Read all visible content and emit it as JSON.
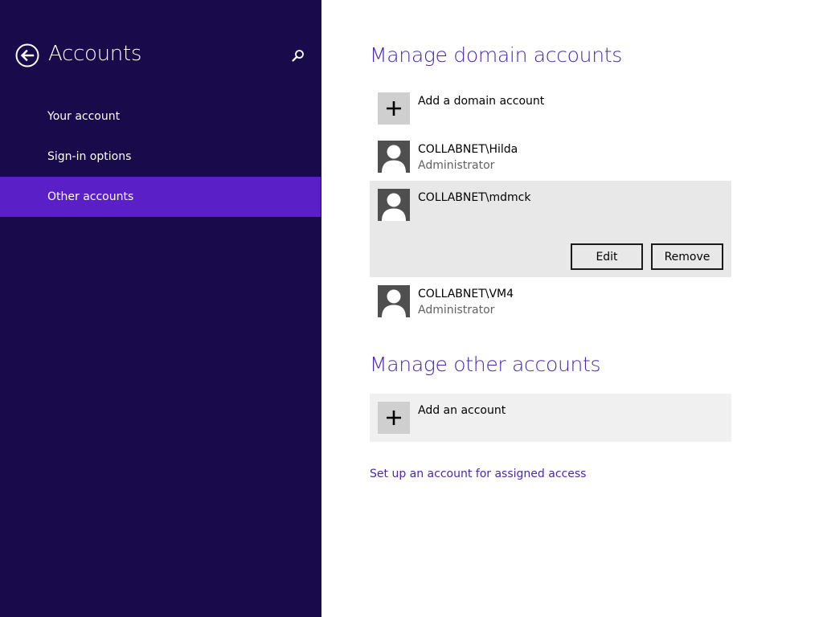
{
  "sidebar": {
    "title": "Accounts",
    "back_icon": "back-arrow-icon",
    "search_icon": "search-icon",
    "items": [
      {
        "label": "Your account",
        "selected": false
      },
      {
        "label": "Sign-in options",
        "selected": false
      },
      {
        "label": "Other accounts",
        "selected": true
      }
    ]
  },
  "domain_section": {
    "title": "Manage domain accounts",
    "add_label": "Add a domain account",
    "accounts": [
      {
        "name": "COLLABNET\\Hilda",
        "role": "Administrator"
      },
      {
        "name": "COLLABNET\\mdmck",
        "role": "",
        "expanded": true,
        "edit_label": "Edit",
        "remove_label": "Remove"
      },
      {
        "name": "COLLABNET\\VM4",
        "role": "Administrator"
      }
    ]
  },
  "other_section": {
    "title": "Manage other accounts",
    "add_label": "Add an account"
  },
  "assigned_access_link": "Set up an account for assigned access",
  "colors": {
    "sidebar_bg": "#180a4b",
    "sidebar_selected": "#5a1fc6",
    "accent": "#4b27b1",
    "avatar_bg": "#4f4f4f",
    "plus_tile_bg": "#cfcfcf",
    "expanded_row_bg": "#e8e8e8"
  }
}
